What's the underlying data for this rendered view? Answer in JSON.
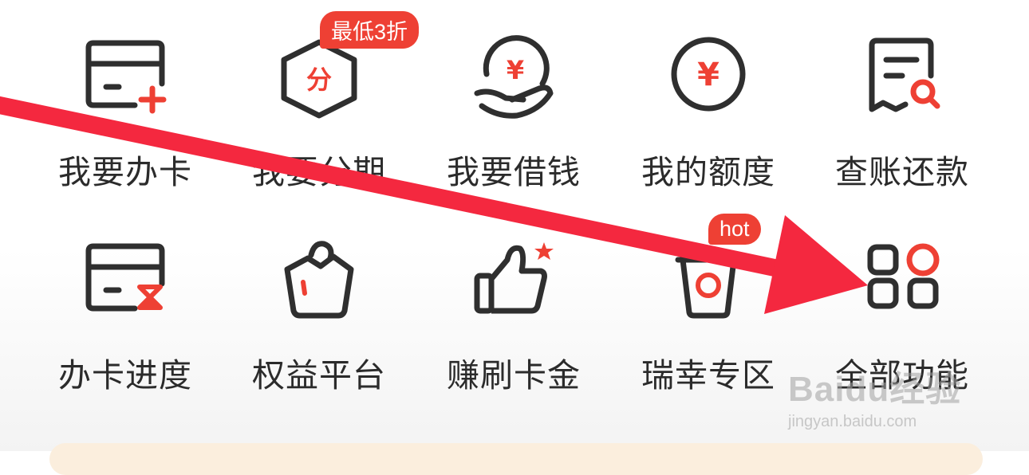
{
  "colors": {
    "accent": "#ee4034",
    "icon_stroke": "#2f2f2f",
    "arrow": "#f4283f",
    "card": "#fbeedd"
  },
  "tiles": [
    {
      "label": "我要办卡",
      "icon": "card-add-icon"
    },
    {
      "label": "我要分期",
      "icon": "installment-hexagon-icon",
      "icon_text": "分",
      "badge": "最低3折"
    },
    {
      "label": "我要借钱",
      "icon": "hand-coin-icon",
      "icon_text": "¥"
    },
    {
      "label": "我的额度",
      "icon": "yuan-circle-icon",
      "icon_text": "¥"
    },
    {
      "label": "查账还款",
      "icon": "bill-search-icon"
    },
    {
      "label": "办卡进度",
      "icon": "card-hourglass-icon"
    },
    {
      "label": "权益平台",
      "icon": "basket-icon"
    },
    {
      "label": "赚刷卡金",
      "icon": "thumbs-up-icon"
    },
    {
      "label": "瑞幸专区",
      "icon": "coffee-cup-icon",
      "badge": "hot"
    },
    {
      "label": "全部功能",
      "icon": "all-functions-grid-icon"
    }
  ],
  "watermark": {
    "logo_text": "Baidu经验",
    "url": "jingyan.baidu.com"
  }
}
